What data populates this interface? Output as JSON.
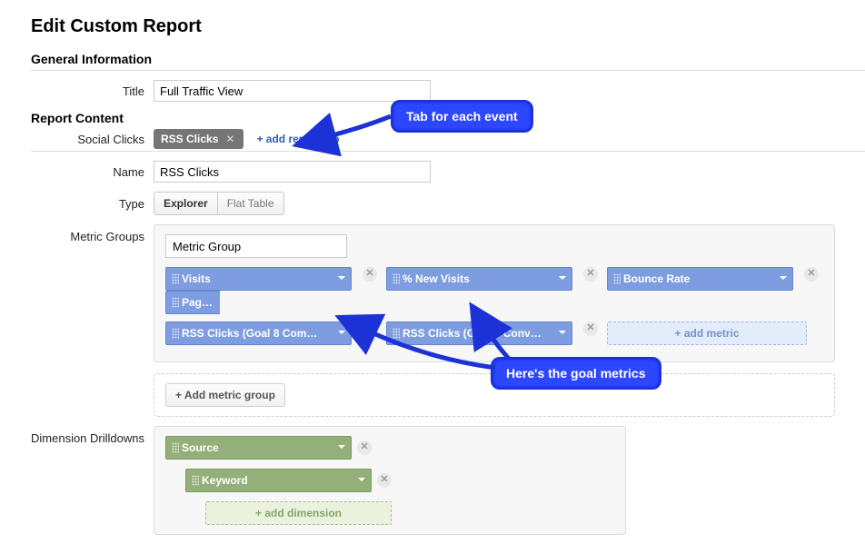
{
  "page_title": "Edit Custom Report",
  "sections": {
    "general": "General Information",
    "content": "Report Content"
  },
  "labels": {
    "title": "Title",
    "social_clicks": "Social Clicks",
    "name": "Name",
    "type": "Type",
    "metric_groups": "Metric Groups",
    "dimension_drilldowns": "Dimension Drilldowns"
  },
  "values": {
    "title": "Full Traffic View",
    "name": "RSS Clicks",
    "metric_group_name": "Metric Group"
  },
  "tabs": {
    "active": "RSS Clicks",
    "add": "+ add report tab"
  },
  "type_options": {
    "explorer": "Explorer",
    "flat": "Flat Table"
  },
  "metrics_row1": [
    "Visits",
    "% New Visits",
    "Bounce Rate",
    "Pages / V"
  ],
  "metrics_row2": [
    "RSS Clicks (Goal 8 Com…",
    "RSS Clicks (Goal 8 Conv…"
  ],
  "add_metric": "+ add metric",
  "add_metric_group": "+ Add metric group",
  "dimensions": {
    "d1": "Source",
    "d2": "Keyword"
  },
  "add_dimension": "+ add dimension",
  "callouts": {
    "tabs": "Tab for each event",
    "goals": "Here's the goal metrics"
  }
}
